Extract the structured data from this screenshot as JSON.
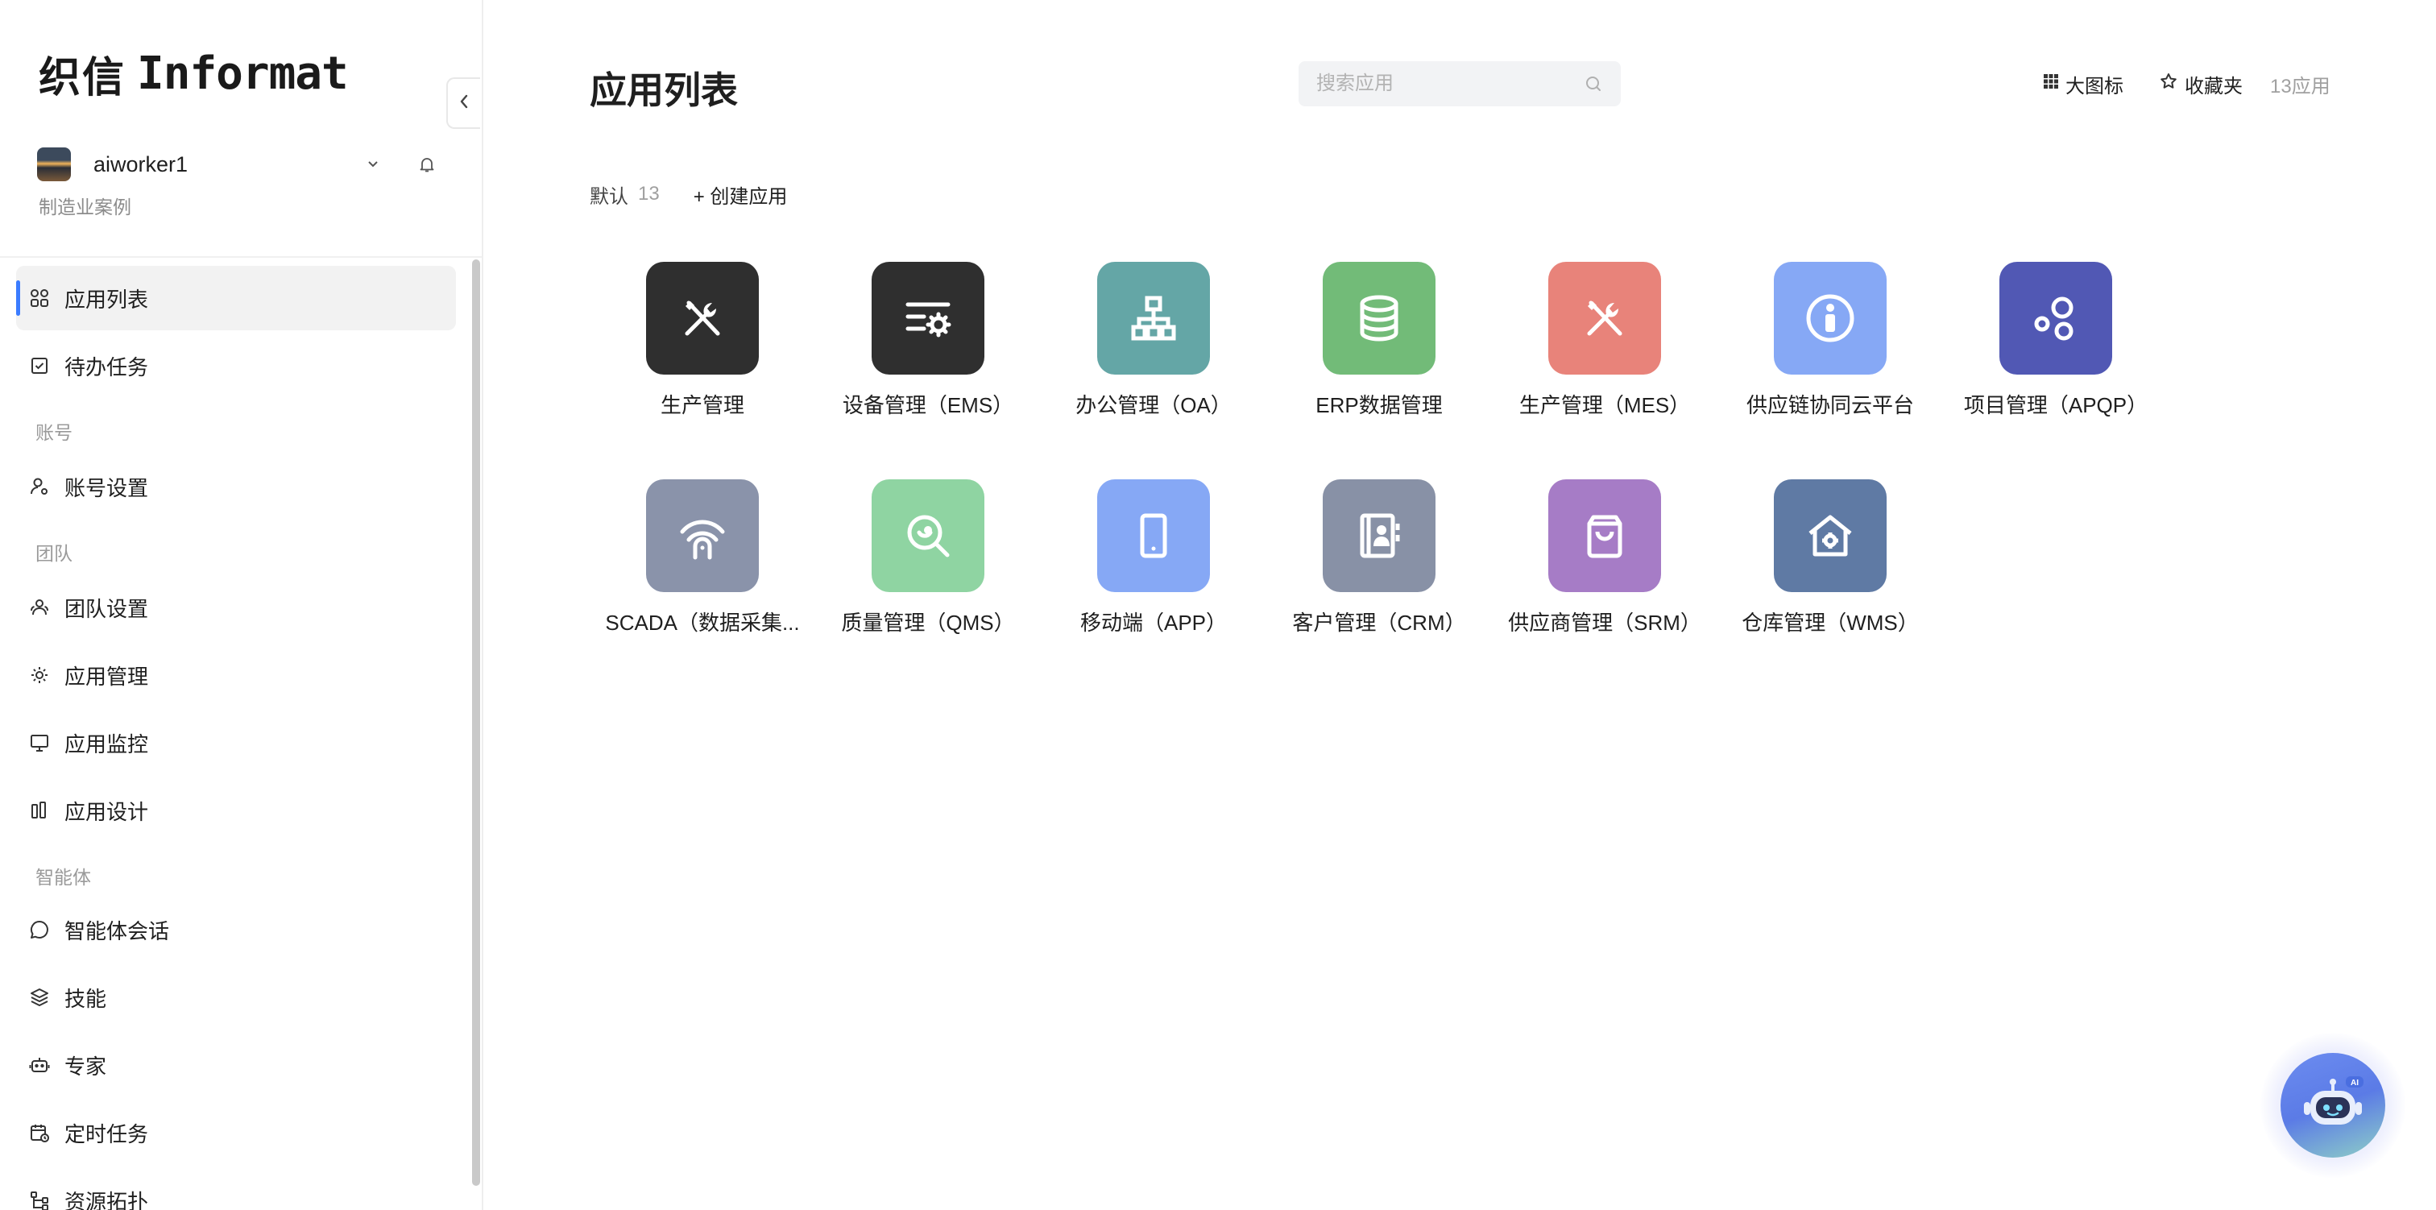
{
  "brand": {
    "logo_cn": "织信",
    "logo_en": "Informat"
  },
  "user": {
    "name": "aiworker1",
    "org": "制造业案例"
  },
  "nav": {
    "app_list": "应用列表",
    "todo": "待办任务",
    "section_account": "账号",
    "account_settings": "账号设置",
    "section_team": "团队",
    "team_settings": "团队设置",
    "app_manage": "应用管理",
    "app_monitor": "应用监控",
    "app_design": "应用设计",
    "section_agent": "智能体",
    "agent_chat": "智能体会话",
    "skills": "技能",
    "experts": "专家",
    "scheduled_tasks": "定时任务",
    "resource_topology": "资源拓扑"
  },
  "header": {
    "title": "应用列表",
    "search_placeholder": "搜索应用",
    "large_icons": "大图标",
    "favorites": "收藏夹",
    "app_count": "13应用"
  },
  "group": {
    "name": "默认",
    "count": "13",
    "create_label": "+ 创建应用"
  },
  "apps": [
    {
      "name": "生产管理",
      "icon": "tools-icon",
      "color": "#2f2f2f"
    },
    {
      "name": "设备管理（EMS）",
      "icon": "list-gear-icon",
      "color": "#2f2f2f"
    },
    {
      "name": "办公管理（OA）",
      "icon": "org-chart-icon",
      "color": "#64a6a6"
    },
    {
      "name": "ERP数据管理",
      "icon": "database-icon",
      "color": "#72bb78"
    },
    {
      "name": "生产管理（MES）",
      "icon": "tools-icon",
      "color": "#e8837a"
    },
    {
      "name": "供应链协同云平台",
      "icon": "info-person-icon",
      "color": "#86a8f5"
    },
    {
      "name": "项目管理（APQP）",
      "icon": "circles-icon",
      "color": "#5158b4"
    },
    {
      "name": "SCADA（数据采集...",
      "icon": "signal-door-icon",
      "color": "#8a93aa"
    },
    {
      "name": "质量管理（QMS）",
      "icon": "search-check-icon",
      "color": "#8fd4a2"
    },
    {
      "name": "移动端（APP）",
      "icon": "phone-icon",
      "color": "#86a8f5"
    },
    {
      "name": "客户管理（CRM）",
      "icon": "contacts-icon",
      "color": "#8891a6"
    },
    {
      "name": "供应商管理（SRM）",
      "icon": "bag-icon",
      "color": "#a67cc6"
    },
    {
      "name": "仓库管理（WMS）",
      "icon": "warehouse-icon",
      "color": "#5f7aa4"
    }
  ]
}
